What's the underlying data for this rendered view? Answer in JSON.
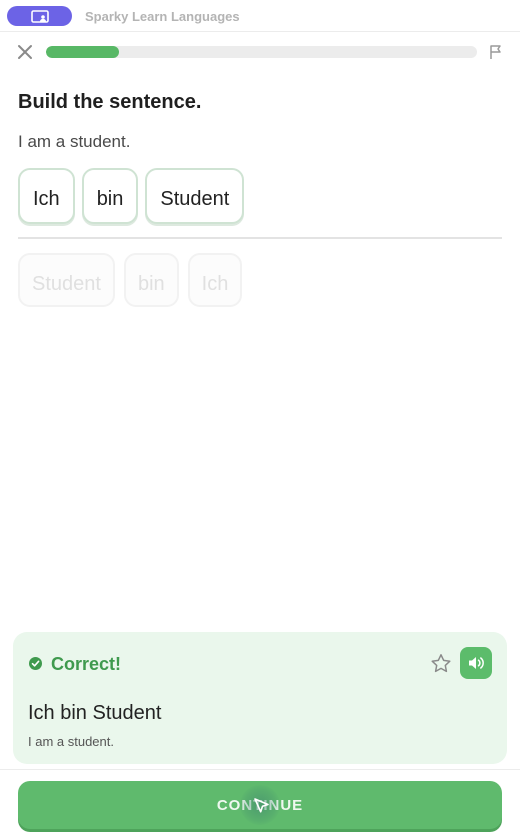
{
  "app": {
    "title": "Sparky Learn Languages",
    "accent": "#6c63e6"
  },
  "progress": {
    "fraction": 0.17,
    "color": "#58b866"
  },
  "lesson": {
    "heading": "Build the sentence.",
    "prompt": "I am a student.",
    "answer_words": [
      "Ich",
      "bin",
      "Student"
    ],
    "bank_words": [
      "Student",
      "bin",
      "Ich"
    ]
  },
  "feedback": {
    "status": "Correct!",
    "answer": "Ich bin Student",
    "translation": "I am a student.",
    "color": "#3f9a4e"
  },
  "footer": {
    "continue_label": "CONTINUE"
  },
  "icons": {
    "app": "app-window-icon",
    "close": "close-icon",
    "flag": "flag-icon",
    "check": "check-circle-icon",
    "star": "star-icon",
    "speaker": "speaker-icon",
    "cursor": "cursor-pointer-icon"
  }
}
